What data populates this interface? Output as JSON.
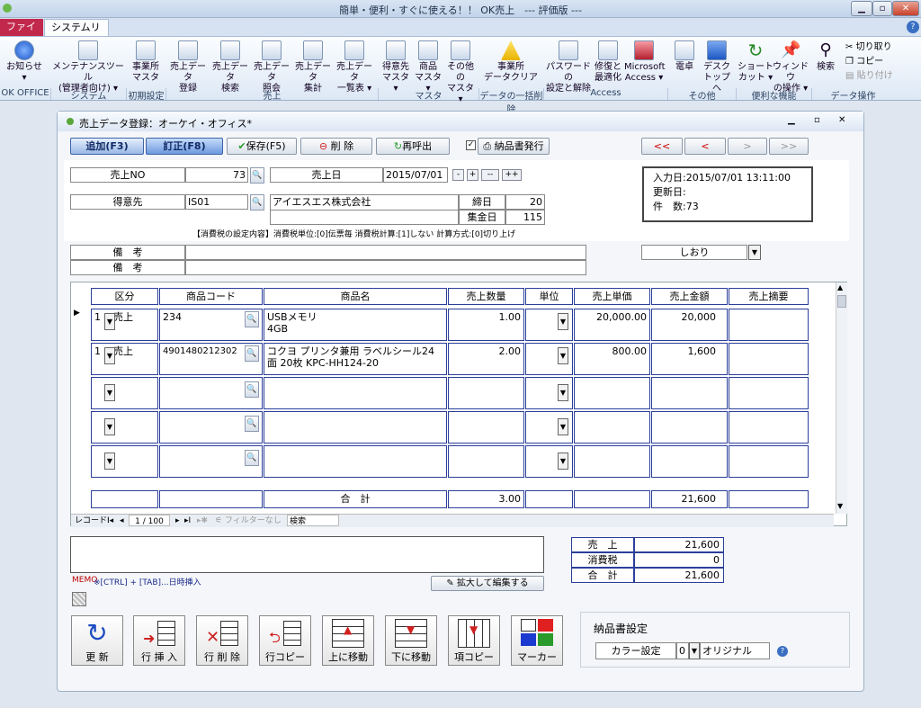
{
  "app": {
    "title": "簡単・便利・すぐに使える！！ OK売上　--- 評価版 ---"
  },
  "ribbon": {
    "tabs": [
      "ファイル",
      "システムリボン"
    ],
    "buttons": [
      {
        "label": "お知らせ",
        "sub": "▾"
      },
      {
        "label": "メンテナンスツール",
        "sub": "(管理者向け) ▾"
      },
      {
        "label": "事業所",
        "sub": "マスタ"
      },
      {
        "label": "売上データ",
        "sub": "登録"
      },
      {
        "label": "売上データ",
        "sub": "検索"
      },
      {
        "label": "売上データ",
        "sub": "照会"
      },
      {
        "label": "売上データ",
        "sub": "集計"
      },
      {
        "label": "売上データ",
        "sub": "一覧表 ▾"
      },
      {
        "label": "得意先",
        "sub": "マスタ ▾"
      },
      {
        "label": "商品",
        "sub": "マスタ ▾"
      },
      {
        "label": "その他の",
        "sub": "マスタ ▾"
      },
      {
        "label": "事業所",
        "sub": "データクリア"
      },
      {
        "label": "パスワードの",
        "sub": "設定と解除"
      },
      {
        "label": "修復と",
        "sub": "最適化"
      },
      {
        "label": "Microsoft",
        "sub": "Access ▾"
      },
      {
        "label": "電卓",
        "sub": ""
      },
      {
        "label": "デスク",
        "sub": "トップへ"
      },
      {
        "label": "ショート",
        "sub": "カット ▾"
      },
      {
        "label": "ウィンドウ",
        "sub": "の操作 ▾"
      },
      {
        "label": "検索",
        "sub": ""
      }
    ],
    "clip": [
      "切り取り",
      "コピー",
      "貼り付け"
    ],
    "groups": [
      "OK OFFICE",
      "システム",
      "初期設定",
      "売上",
      "マスタ",
      "データの一括削除",
      "Access",
      "その他",
      "便利な機能",
      "データ操作"
    ]
  },
  "window": {
    "title": "売上データ登録：オーケイ・オフィス*"
  },
  "toolbar": {
    "add": "追加(F3)",
    "edit": "訂正(F8)",
    "save": "保存(F5)",
    "delete": "削 除",
    "recall": "再呼出",
    "deliver": "納品書発行",
    "nav": [
      "<<",
      "<",
      ">",
      ">>"
    ]
  },
  "header": {
    "no_label": "売上NO",
    "no": "73",
    "date_label": "売上日",
    "date": "2015/07/01",
    "date_btns": [
      "-",
      "+",
      "--",
      "++"
    ],
    "cust_label": "得意先",
    "cust_code": "IS01",
    "cust_name": "アイエスエス株式会社",
    "close_label": "締日",
    "close": "20",
    "collect_label": "集金日",
    "collect": "115",
    "tax_note": "【消費税の設定内容】消費税単位:[0]伝票毎 消費税計算:[1]しない 計算方式:[0]切り上げ",
    "memo1": "備　考",
    "memo2": "備　考",
    "info": {
      "entered": "入力日:2015/07/01 13:11:00",
      "updated": "更新日:",
      "count": "件　数:73"
    },
    "bookmark": "しおり"
  },
  "grid": {
    "columns": [
      "区分",
      "商品コード",
      "商品名",
      "売上数量",
      "単位",
      "売上単価",
      "売上金額",
      "売上摘要"
    ],
    "rows": [
      {
        "kubun": "1",
        "kubun_name": "売上",
        "code": "234",
        "name": "USBメモリ\n4GB",
        "qty": "1.00",
        "unit": "",
        "price": "20,000.00",
        "amount": "20,000",
        "memo": ""
      },
      {
        "kubun": "1",
        "kubun_name": "売上",
        "code": "4901480212302",
        "name": "コクヨ プリンタ兼用 ラベルシール24面 20枚 KPC-HH124-20",
        "qty": "2.00",
        "unit": "",
        "price": "800.00",
        "amount": "1,600",
        "memo": ""
      }
    ],
    "total_label": "合　計",
    "total_qty": "3.00",
    "total_amount": "21,600",
    "record": {
      "label": "レコード:",
      "pos": "1 / 100",
      "filter": "フィルターなし",
      "search": "検索"
    }
  },
  "summary": {
    "sales_label": "売　上",
    "sales": "21,600",
    "tax_label": "消費税",
    "tax": "0",
    "total_label": "合　計",
    "total": "21,600"
  },
  "memo": {
    "label": "MEMO",
    "hint": "※[CTRL] + [TAB]...日時挿入",
    "expand": "拡大して編集する"
  },
  "actions": [
    "更 新",
    "行 挿 入",
    "行 削 除",
    "行コピー",
    "上に移動",
    "下に移動",
    "項コピー",
    "マーカー"
  ],
  "delivery": {
    "title": "納品書設定",
    "color_label": "カラー設定",
    "color_value": "0",
    "color_name": "オリジナル"
  }
}
